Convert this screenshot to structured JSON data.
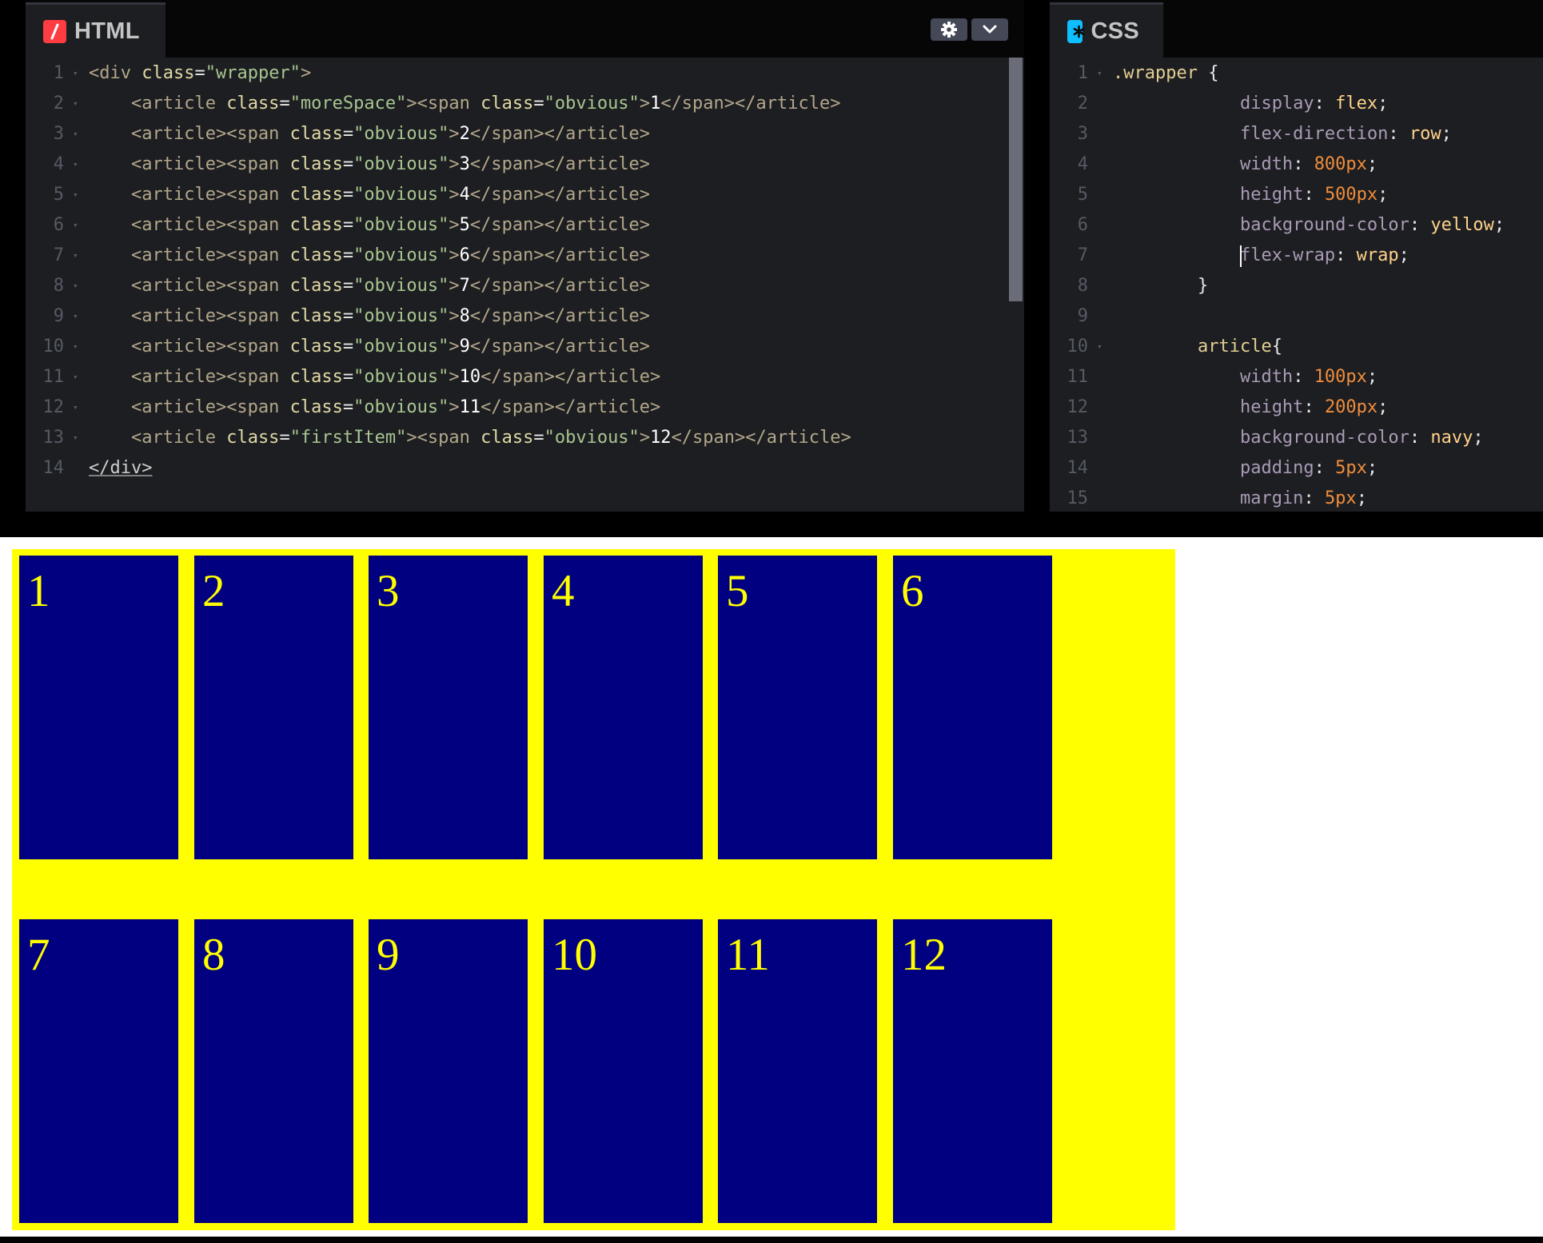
{
  "html_panel": {
    "title": "HTML",
    "icon": "html-slash-icon",
    "accent": "#ff3c41",
    "lines": [
      {
        "n": "1",
        "tokens": [
          [
            "tg",
            "<div "
          ],
          [
            "at",
            "class"
          ],
          [
            "pn",
            "="
          ],
          [
            "av",
            "\"wrapper\""
          ],
          [
            "tg",
            ">"
          ]
        ]
      },
      {
        "n": "2",
        "tokens": [
          [
            "pn",
            "    "
          ],
          [
            "tg",
            "<article "
          ],
          [
            "at",
            "class"
          ],
          [
            "pn",
            "="
          ],
          [
            "av",
            "\"moreSpace\""
          ],
          [
            "tg",
            "><span "
          ],
          [
            "at",
            "class"
          ],
          [
            "pn",
            "="
          ],
          [
            "av",
            "\"obvious\""
          ],
          [
            "tg",
            ">"
          ],
          [
            "tx",
            "1"
          ],
          [
            "tg",
            "</span></article>"
          ]
        ]
      },
      {
        "n": "3",
        "tokens": [
          [
            "pn",
            "    "
          ],
          [
            "tg",
            "<article><span "
          ],
          [
            "at",
            "class"
          ],
          [
            "pn",
            "="
          ],
          [
            "av",
            "\"obvious\""
          ],
          [
            "tg",
            ">"
          ],
          [
            "tx",
            "2"
          ],
          [
            "tg",
            "</span></article>"
          ]
        ]
      },
      {
        "n": "4",
        "tokens": [
          [
            "pn",
            "    "
          ],
          [
            "tg",
            "<article><span "
          ],
          [
            "at",
            "class"
          ],
          [
            "pn",
            "="
          ],
          [
            "av",
            "\"obvious\""
          ],
          [
            "tg",
            ">"
          ],
          [
            "tx",
            "3"
          ],
          [
            "tg",
            "</span></article>"
          ]
        ]
      },
      {
        "n": "5",
        "tokens": [
          [
            "pn",
            "    "
          ],
          [
            "tg",
            "<article><span "
          ],
          [
            "at",
            "class"
          ],
          [
            "pn",
            "="
          ],
          [
            "av",
            "\"obvious\""
          ],
          [
            "tg",
            ">"
          ],
          [
            "tx",
            "4"
          ],
          [
            "tg",
            "</span></article>"
          ]
        ]
      },
      {
        "n": "6",
        "tokens": [
          [
            "pn",
            "    "
          ],
          [
            "tg",
            "<article><span "
          ],
          [
            "at",
            "class"
          ],
          [
            "pn",
            "="
          ],
          [
            "av",
            "\"obvious\""
          ],
          [
            "tg",
            ">"
          ],
          [
            "tx",
            "5"
          ],
          [
            "tg",
            "</span></article>"
          ]
        ]
      },
      {
        "n": "7",
        "tokens": [
          [
            "pn",
            "    "
          ],
          [
            "tg",
            "<article><span "
          ],
          [
            "at",
            "class"
          ],
          [
            "pn",
            "="
          ],
          [
            "av",
            "\"obvious\""
          ],
          [
            "tg",
            ">"
          ],
          [
            "tx",
            "6"
          ],
          [
            "tg",
            "</span></article>"
          ]
        ]
      },
      {
        "n": "8",
        "tokens": [
          [
            "pn",
            "    "
          ],
          [
            "tg",
            "<article><span "
          ],
          [
            "at",
            "class"
          ],
          [
            "pn",
            "="
          ],
          [
            "av",
            "\"obvious\""
          ],
          [
            "tg",
            ">"
          ],
          [
            "tx",
            "7"
          ],
          [
            "tg",
            "</span></article>"
          ]
        ]
      },
      {
        "n": "9",
        "tokens": [
          [
            "pn",
            "    "
          ],
          [
            "tg",
            "<article><span "
          ],
          [
            "at",
            "class"
          ],
          [
            "pn",
            "="
          ],
          [
            "av",
            "\"obvious\""
          ],
          [
            "tg",
            ">"
          ],
          [
            "tx",
            "8"
          ],
          [
            "tg",
            "</span></article>"
          ]
        ]
      },
      {
        "n": "10",
        "tokens": [
          [
            "pn",
            "    "
          ],
          [
            "tg",
            "<article><span "
          ],
          [
            "at",
            "class"
          ],
          [
            "pn",
            "="
          ],
          [
            "av",
            "\"obvious\""
          ],
          [
            "tg",
            ">"
          ],
          [
            "tx",
            "9"
          ],
          [
            "tg",
            "</span></article>"
          ]
        ]
      },
      {
        "n": "11",
        "tokens": [
          [
            "pn",
            "    "
          ],
          [
            "tg",
            "<article><span "
          ],
          [
            "at",
            "class"
          ],
          [
            "pn",
            "="
          ],
          [
            "av",
            "\"obvious\""
          ],
          [
            "tg",
            ">"
          ],
          [
            "tx",
            "10"
          ],
          [
            "tg",
            "</span></article>"
          ]
        ]
      },
      {
        "n": "12",
        "tokens": [
          [
            "pn",
            "    "
          ],
          [
            "tg",
            "<article><span "
          ],
          [
            "at",
            "class"
          ],
          [
            "pn",
            "="
          ],
          [
            "av",
            "\"obvious\""
          ],
          [
            "tg",
            ">"
          ],
          [
            "tx",
            "11"
          ],
          [
            "tg",
            "</span></article>"
          ]
        ]
      },
      {
        "n": "13",
        "tokens": [
          [
            "pn",
            "    "
          ],
          [
            "tg",
            "<article "
          ],
          [
            "at",
            "class"
          ],
          [
            "pn",
            "="
          ],
          [
            "av",
            "\"firstItem\""
          ],
          [
            "tg",
            "><span "
          ],
          [
            "at",
            "class"
          ],
          [
            "pn",
            "="
          ],
          [
            "av",
            "\"obvious\""
          ],
          [
            "tg",
            ">"
          ],
          [
            "tx",
            "12"
          ],
          [
            "tg",
            "</span></article>"
          ]
        ]
      },
      {
        "n": "14",
        "tokens": [
          [
            "closetag",
            "</div>"
          ]
        ]
      }
    ]
  },
  "css_panel": {
    "title": "CSS",
    "icon": "css-asterisk-icon",
    "accent": "#0ebeff",
    "lines": [
      {
        "n": "1",
        "tokens": [
          [
            "sel",
            ".wrapper "
          ],
          [
            "pn",
            "{"
          ]
        ]
      },
      {
        "n": "2",
        "tokens": [
          [
            "pn",
            "            "
          ],
          [
            "pr",
            "display"
          ],
          [
            "pn",
            ": "
          ],
          [
            "vl",
            "flex"
          ],
          [
            "pn",
            ";"
          ]
        ]
      },
      {
        "n": "3",
        "tokens": [
          [
            "pn",
            "            "
          ],
          [
            "pr",
            "flex-direction"
          ],
          [
            "pn",
            ": "
          ],
          [
            "vl",
            "row"
          ],
          [
            "pn",
            ";"
          ]
        ]
      },
      {
        "n": "4",
        "tokens": [
          [
            "pn",
            "            "
          ],
          [
            "pr",
            "width"
          ],
          [
            "pn",
            ": "
          ],
          [
            "nm",
            "800px"
          ],
          [
            "pn",
            ";"
          ]
        ]
      },
      {
        "n": "5",
        "tokens": [
          [
            "pn",
            "            "
          ],
          [
            "pr",
            "height"
          ],
          [
            "pn",
            ": "
          ],
          [
            "nm",
            "500px"
          ],
          [
            "pn",
            ";"
          ]
        ]
      },
      {
        "n": "6",
        "tokens": [
          [
            "pn",
            "            "
          ],
          [
            "pr",
            "background-color"
          ],
          [
            "pn",
            ": "
          ],
          [
            "vl",
            "yellow"
          ],
          [
            "pn",
            ";"
          ]
        ]
      },
      {
        "n": "7",
        "tokens": [
          [
            "pn",
            "            "
          ],
          [
            "cursor",
            ""
          ],
          [
            "pr",
            "flex-wrap"
          ],
          [
            "pn",
            ": "
          ],
          [
            "vl",
            "wrap"
          ],
          [
            "pn",
            ";"
          ]
        ]
      },
      {
        "n": "8",
        "tokens": [
          [
            "pn",
            "        }"
          ]
        ]
      },
      {
        "n": "9",
        "tokens": []
      },
      {
        "n": "10",
        "tokens": [
          [
            "pn",
            "        "
          ],
          [
            "sel",
            "article"
          ],
          [
            "pn",
            "{"
          ]
        ]
      },
      {
        "n": "11",
        "tokens": [
          [
            "pn",
            "            "
          ],
          [
            "pr",
            "width"
          ],
          [
            "pn",
            ": "
          ],
          [
            "nm",
            "100px"
          ],
          [
            "pn",
            ";"
          ]
        ]
      },
      {
        "n": "12",
        "tokens": [
          [
            "pn",
            "            "
          ],
          [
            "pr",
            "height"
          ],
          [
            "pn",
            ": "
          ],
          [
            "nm",
            "200px"
          ],
          [
            "pn",
            ";"
          ]
        ]
      },
      {
        "n": "13",
        "tokens": [
          [
            "pn",
            "            "
          ],
          [
            "pr",
            "background-color"
          ],
          [
            "pn",
            ": "
          ],
          [
            "vl",
            "navy"
          ],
          [
            "pn",
            ";"
          ]
        ]
      },
      {
        "n": "14",
        "tokens": [
          [
            "pn",
            "            "
          ],
          [
            "pr",
            "padding"
          ],
          [
            "pn",
            ": "
          ],
          [
            "nm",
            "5px"
          ],
          [
            "pn",
            ";"
          ]
        ]
      },
      {
        "n": "15",
        "tokens": [
          [
            "pn",
            "            "
          ],
          [
            "pr",
            "margin"
          ],
          [
            "pn",
            ": "
          ],
          [
            "nm",
            "5px"
          ],
          [
            "pn",
            ";"
          ]
        ]
      }
    ]
  },
  "html_toolbar": {
    "settings_icon": "gear-icon",
    "collapse_icon": "chevron-down-icon"
  },
  "preview": {
    "wrapper_color": "#ffff00",
    "article_color": "#000080",
    "number_color": "#ffff00",
    "articles": [
      "1",
      "2",
      "3",
      "4",
      "5",
      "6",
      "7",
      "8",
      "9",
      "10",
      "11",
      "12"
    ]
  }
}
